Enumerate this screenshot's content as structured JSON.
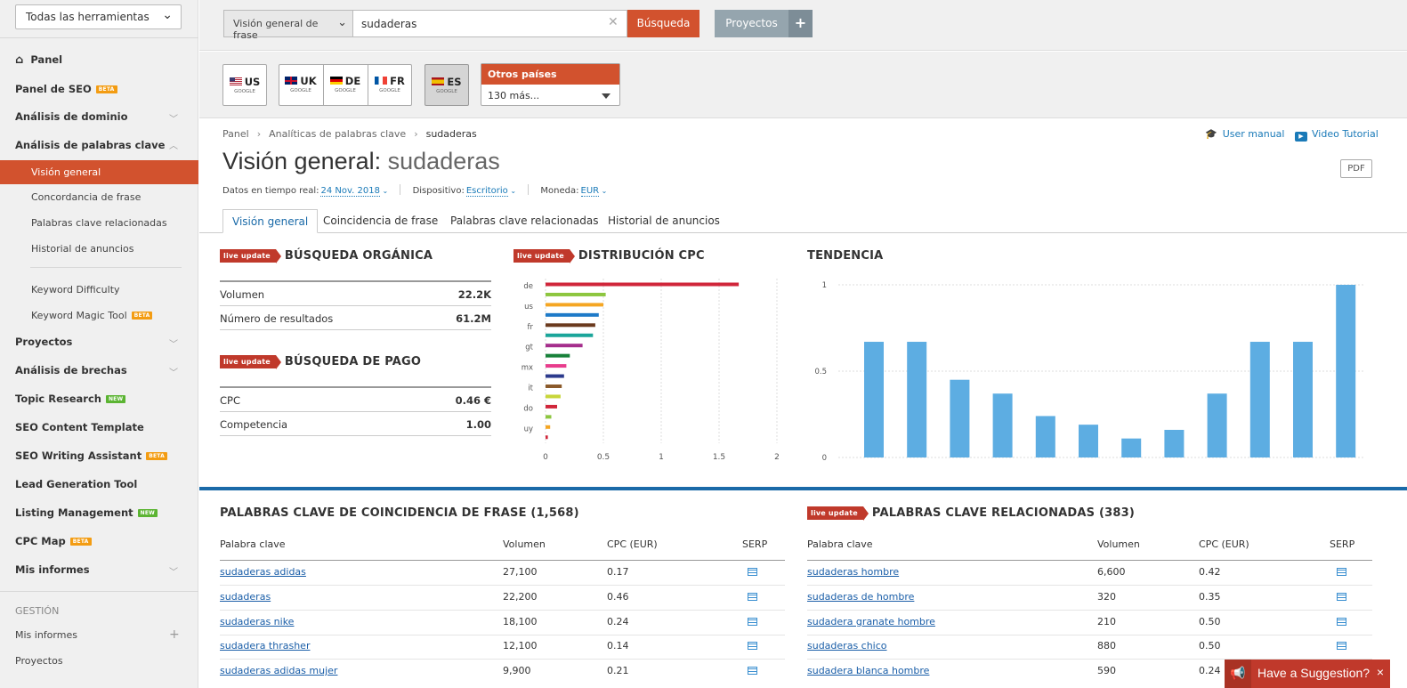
{
  "sidebar": {
    "tools_select": "Todas las herramientas",
    "items": [
      {
        "label": "Panel"
      },
      {
        "label": "Panel de SEO",
        "badge": "BETA"
      },
      {
        "label": "Análisis de dominio"
      },
      {
        "label": "Análisis de palabras clave"
      },
      {
        "label": "Visión general"
      },
      {
        "label": "Concordancia de frase"
      },
      {
        "label": "Palabras clave relacionadas"
      },
      {
        "label": "Historial de anuncios"
      },
      {
        "label": "Keyword Difficulty"
      },
      {
        "label": "Keyword Magic Tool",
        "badge": "BETA"
      },
      {
        "label": "Proyectos"
      },
      {
        "label": "Análisis de brechas"
      },
      {
        "label": "Topic Research",
        "badge": "NEW"
      },
      {
        "label": "SEO Content Template"
      },
      {
        "label": "SEO Writing Assistant",
        "badge": "BETA"
      },
      {
        "label": "Lead Generation Tool"
      },
      {
        "label": "Listing Management",
        "badge": "NEW"
      },
      {
        "label": "CPC Map",
        "badge": "BETA"
      },
      {
        "label": "Mis informes"
      }
    ],
    "gestion_header": "GESTIÓN",
    "gestion_items": [
      "Mis informes",
      "Proyectos"
    ]
  },
  "topbar": {
    "search_type": "Visión general de frase",
    "search_value": "sudaderas",
    "search_button": "Búsqueda",
    "projects_button": "Proyectos",
    "projects_plus": "+"
  },
  "countries": {
    "engine": "GOOGLE",
    "list": [
      "US",
      "UK",
      "DE",
      "FR",
      "ES"
    ],
    "selected": "ES",
    "other_label": "Otros países",
    "other_value": "130 más..."
  },
  "breadcrumb": [
    "Panel",
    "Analíticas de palabras clave",
    "sudaderas"
  ],
  "links": {
    "user_manual": "User manual",
    "video_tutorial": "Video Tutorial",
    "pdf": "PDF"
  },
  "title": {
    "prefix": "Visión general:",
    "keyword": "sudaderas"
  },
  "settings": {
    "date_label": "Datos en tiempo real:",
    "date_value": "24 Nov. 2018",
    "device_label": "Dispositivo:",
    "device_value": "Escritorio",
    "currency_label": "Moneda:",
    "currency_value": "EUR"
  },
  "tabs": [
    "Visión general",
    "Coincidencia de frase",
    "Palabras clave relacionadas",
    "Historial de anuncios"
  ],
  "live_update": "live update",
  "organic": {
    "title": "BÚSQUEDA ORGÁNICA",
    "rows": [
      {
        "label": "Volumen",
        "value": "22.2K"
      },
      {
        "label": "Número de resultados",
        "value": "61.2M"
      }
    ]
  },
  "paid": {
    "title": "BÚSQUEDA DE PAGO",
    "rows": [
      {
        "label": "CPC",
        "value": "0.46 €"
      },
      {
        "label": "Competencia",
        "value": "1.00"
      }
    ]
  },
  "cpc_title": "DISTRIBUCIÓN CPC",
  "trend_title": "TENDENCIA",
  "chart_data": [
    {
      "type": "bar",
      "orientation": "horizontal",
      "title": "DISTRIBUCIÓN CPC",
      "categories": [
        "de",
        "",
        "us",
        "",
        "fr",
        "",
        "gt",
        "",
        "mx",
        "",
        "it",
        "",
        "do",
        "",
        "uy"
      ],
      "values": [
        1.67,
        0.52,
        0.5,
        0.46,
        0.43,
        0.41,
        0.32,
        0.21,
        0.18,
        0.16,
        0.14,
        0.13,
        0.1,
        0.05,
        0.04,
        0.02
      ],
      "colors": [
        "#d0263a",
        "#8dc63f",
        "#f5a623",
        "#1e7ac8",
        "#6b3a1e",
        "#1aa59a",
        "#a52e8c",
        "#18813a",
        "#e83c8c",
        "#2b3a8c",
        "#8b5a2b",
        "#c8d63a",
        "#d0263a",
        "#8dc63f",
        "#f5a623"
      ],
      "x_ticks": [
        "0",
        "0.5",
        "1",
        "1.5",
        "2"
      ],
      "xlim": [
        0,
        2
      ]
    },
    {
      "type": "bar",
      "title": "TENDENCIA",
      "values": [
        0.67,
        0.67,
        0.45,
        0.37,
        0.24,
        0.19,
        0.11,
        0.16,
        0.37,
        0.67,
        0.67,
        1.0
      ],
      "y_ticks": [
        "1",
        "0.5",
        "0"
      ],
      "ylim": [
        0,
        1
      ],
      "color": "#5dade2"
    }
  ],
  "phrase_table": {
    "title": "PALABRAS CLAVE DE COINCIDENCIA DE FRASE (1,568)",
    "headers": [
      "Palabra clave",
      "Volumen",
      "CPC (EUR)",
      "SERP"
    ],
    "rows": [
      [
        "sudaderas adidas",
        "27,100",
        "0.17"
      ],
      [
        "sudaderas",
        "22,200",
        "0.46"
      ],
      [
        "sudaderas nike",
        "18,100",
        "0.24"
      ],
      [
        "sudadera thrasher",
        "12,100",
        "0.14"
      ],
      [
        "sudaderas adidas mujer",
        "9,900",
        "0.21"
      ]
    ]
  },
  "related_table": {
    "title": "PALABRAS CLAVE RELACIONADAS (383)",
    "headers": [
      "Palabra clave",
      "Volumen",
      "CPC (EUR)",
      "SERP"
    ],
    "rows": [
      [
        "sudaderas hombre",
        "6,600",
        "0.42"
      ],
      [
        "sudaderas de hombre",
        "320",
        "0.35"
      ],
      [
        "sudadera granate hombre",
        "210",
        "0.50"
      ],
      [
        "sudaderas chico",
        "880",
        "0.50"
      ],
      [
        "sudadera blanca hombre",
        "590",
        "0.24"
      ]
    ]
  },
  "suggestion": {
    "label": "Have a Suggestion?",
    "close": "×"
  }
}
